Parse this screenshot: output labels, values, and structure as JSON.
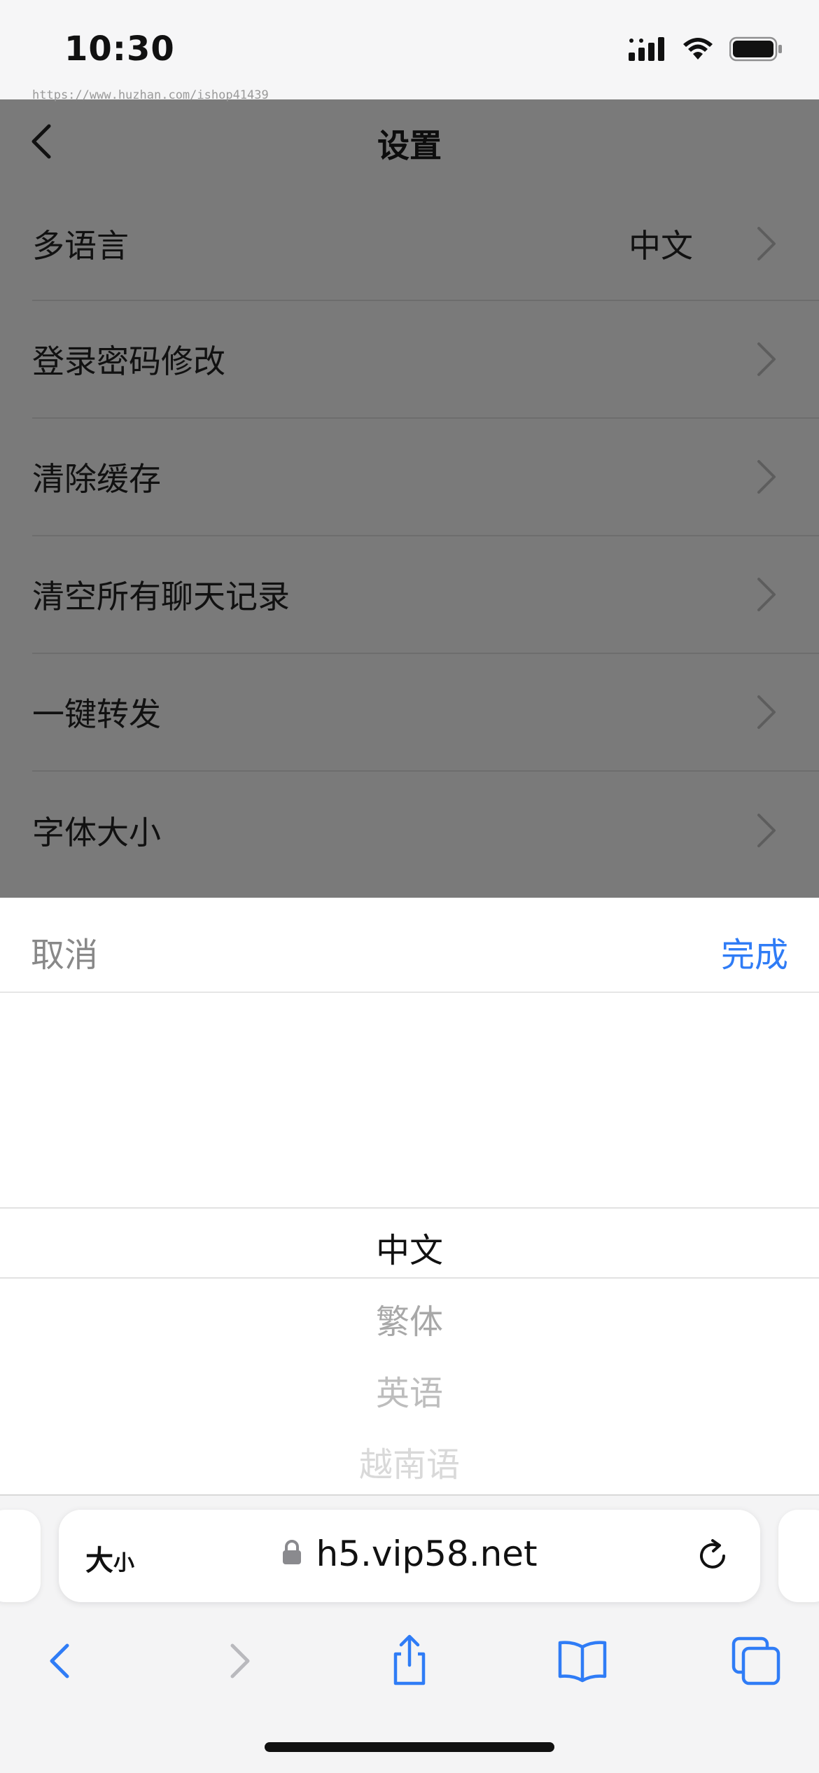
{
  "status_bar": {
    "time": "10:30",
    "watermark": "https://www.huzhan.com/ishop41439"
  },
  "settings": {
    "title": "设置",
    "items": [
      {
        "label": "多语言",
        "value": "中文"
      },
      {
        "label": "登录密码修改"
      },
      {
        "label": "清除缓存"
      },
      {
        "label": "清空所有聊天记录"
      },
      {
        "label": "一键转发"
      },
      {
        "label": "字体大小"
      }
    ]
  },
  "picker": {
    "cancel_label": "取消",
    "done_label": "完成",
    "options": [
      "中文",
      "繁体",
      "英语",
      "越南语"
    ],
    "selected": "中文"
  },
  "browser": {
    "text_size_label": "大",
    "text_size_small": "小",
    "url": "h5.vip58.net",
    "toolbar_icons": [
      "back-icon",
      "forward-icon",
      "share-icon",
      "bookmarks-icon",
      "tabs-icon"
    ]
  },
  "colors": {
    "accent": "#2f7cf6",
    "overlay": "rgba(0,0,0,0.5)"
  }
}
